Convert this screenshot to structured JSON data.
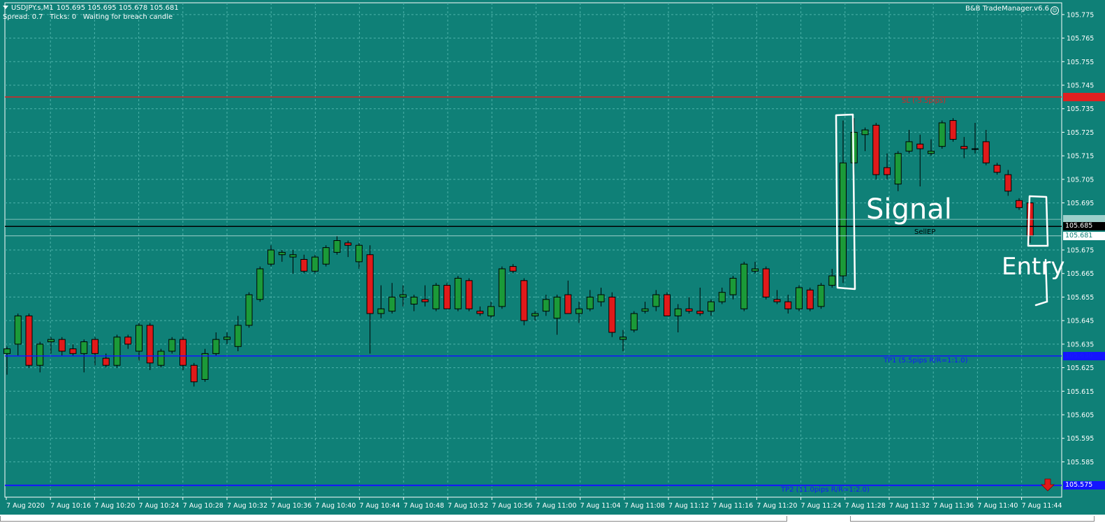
{
  "header": {
    "symbol": "USDJPY.s,M1",
    "ohlc": "105.695 105.695 105.678 105.681",
    "status_line": "Spread: 0.7   Ticks: 0   Waiting for breach candle",
    "ea_name": "B&B TradeManager.v6.6",
    "ea_icon": "smiley-icon"
  },
  "colors": {
    "background": "#0f8077",
    "grid": "#4db2aa",
    "bull": "#1b9a38",
    "bear": "#e01a1a",
    "wick": "#000000",
    "sl_line": "#e02020",
    "tp_line": "#1414ff",
    "entry_line": "#000000",
    "annotation": "#ffffff"
  },
  "price_axis": {
    "min": 105.57,
    "max": 105.78,
    "ticks": [
      "105.775",
      "105.765",
      "105.755",
      "105.745",
      "105.735",
      "105.725",
      "105.715",
      "105.705",
      "105.695",
      "105.675",
      "105.665",
      "105.655",
      "105.645",
      "105.635",
      "105.625",
      "105.615",
      "105.605",
      "105.595",
      "105.585"
    ]
  },
  "time_axis": {
    "labels": [
      "7 Aug 2020",
      "7 Aug 10:16",
      "7 Aug 10:20",
      "7 Aug 10:24",
      "7 Aug 10:28",
      "7 Aug 10:32",
      "7 Aug 10:36",
      "7 Aug 10:40",
      "7 Aug 10:44",
      "7 Aug 10:48",
      "7 Aug 10:52",
      "7 Aug 10:56",
      "7 Aug 11:00",
      "7 Aug 11:04",
      "7 Aug 11:08",
      "7 Aug 11:12",
      "7 Aug 11:16",
      "7 Aug 11:20",
      "7 Aug 11:24",
      "7 Aug 11:28",
      "7 Aug 11:32",
      "7 Aug 11:36",
      "7 Aug 11:40",
      "7 Aug 11:44"
    ]
  },
  "levels": {
    "sl": {
      "price": 105.74,
      "tag": "105.740",
      "label": "SL (-5.5pips)"
    },
    "entry": {
      "price": 105.685,
      "tag": "105.685",
      "label": "SellEP"
    },
    "tp1": {
      "price": 105.63,
      "tag": "105.630",
      "label": "TP1 (5.5pips R/R=1:1.0)"
    },
    "tp2": {
      "price": 105.575,
      "tag": "105.575",
      "label": "TP2 (11.0pips R/R=1:2.0)"
    },
    "ask": {
      "price": 105.688,
      "tag": "105.688"
    },
    "bid": {
      "price": 105.681,
      "tag": "105.681"
    }
  },
  "annotations": {
    "signal": "Signal",
    "entry": "Entry"
  },
  "chart_data": {
    "type": "candlestick",
    "title": "",
    "xlabel": "",
    "ylabel": "",
    "ylim": [
      105.57,
      105.78
    ],
    "candles": [
      {
        "o": 105.631,
        "h": 105.634,
        "l": 105.622,
        "c": 105.633
      },
      {
        "o": 105.635,
        "h": 105.648,
        "l": 105.63,
        "c": 105.647
      },
      {
        "o": 105.647,
        "h": 105.648,
        "l": 105.625,
        "c": 105.626
      },
      {
        "o": 105.626,
        "h": 105.636,
        "l": 105.623,
        "c": 105.635
      },
      {
        "o": 105.636,
        "h": 105.638,
        "l": 105.631,
        "c": 105.637
      },
      {
        "o": 105.637,
        "h": 105.638,
        "l": 105.63,
        "c": 105.632
      },
      {
        "o": 105.633,
        "h": 105.635,
        "l": 105.63,
        "c": 105.631
      },
      {
        "o": 105.631,
        "h": 105.637,
        "l": 105.623,
        "c": 105.636
      },
      {
        "o": 105.637,
        "h": 105.638,
        "l": 105.626,
        "c": 105.631
      },
      {
        "o": 105.629,
        "h": 105.631,
        "l": 105.625,
        "c": 105.626
      },
      {
        "o": 105.626,
        "h": 105.639,
        "l": 105.625,
        "c": 105.638
      },
      {
        "o": 105.638,
        "h": 105.639,
        "l": 105.633,
        "c": 105.635
      },
      {
        "o": 105.632,
        "h": 105.644,
        "l": 105.628,
        "c": 105.643
      },
      {
        "o": 105.643,
        "h": 105.644,
        "l": 105.624,
        "c": 105.627
      },
      {
        "o": 105.626,
        "h": 105.633,
        "l": 105.625,
        "c": 105.632
      },
      {
        "o": 105.632,
        "h": 105.638,
        "l": 105.631,
        "c": 105.637
      },
      {
        "o": 105.637,
        "h": 105.638,
        "l": 105.624,
        "c": 105.626
      },
      {
        "o": 105.626,
        "h": 105.627,
        "l": 105.617,
        "c": 105.619
      },
      {
        "o": 105.62,
        "h": 105.633,
        "l": 105.619,
        "c": 105.631
      },
      {
        "o": 105.631,
        "h": 105.64,
        "l": 105.63,
        "c": 105.637
      },
      {
        "o": 105.637,
        "h": 105.64,
        "l": 105.635,
        "c": 105.638
      },
      {
        "o": 105.634,
        "h": 105.647,
        "l": 105.632,
        "c": 105.643
      },
      {
        "o": 105.643,
        "h": 105.657,
        "l": 105.642,
        "c": 105.656
      },
      {
        "o": 105.654,
        "h": 105.668,
        "l": 105.653,
        "c": 105.667
      },
      {
        "o": 105.669,
        "h": 105.677,
        "l": 105.668,
        "c": 105.675
      },
      {
        "o": 105.673,
        "h": 105.675,
        "l": 105.67,
        "c": 105.674
      },
      {
        "o": 105.672,
        "h": 105.675,
        "l": 105.665,
        "c": 105.673
      },
      {
        "o": 105.671,
        "h": 105.673,
        "l": 105.665,
        "c": 105.666
      },
      {
        "o": 105.666,
        "h": 105.673,
        "l": 105.665,
        "c": 105.672
      },
      {
        "o": 105.669,
        "h": 105.677,
        "l": 105.668,
        "c": 105.676
      },
      {
        "o": 105.674,
        "h": 105.681,
        "l": 105.673,
        "c": 105.679
      },
      {
        "o": 105.678,
        "h": 105.679,
        "l": 105.672,
        "c": 105.677
      },
      {
        "o": 105.67,
        "h": 105.678,
        "l": 105.667,
        "c": 105.677
      },
      {
        "o": 105.673,
        "h": 105.677,
        "l": 105.631,
        "c": 105.648
      },
      {
        "o": 105.648,
        "h": 105.66,
        "l": 105.646,
        "c": 105.65
      },
      {
        "o": 105.649,
        "h": 105.661,
        "l": 105.648,
        "c": 105.655
      },
      {
        "o": 105.655,
        "h": 105.66,
        "l": 105.651,
        "c": 105.656
      },
      {
        "o": 105.652,
        "h": 105.656,
        "l": 105.649,
        "c": 105.655
      },
      {
        "o": 105.654,
        "h": 105.66,
        "l": 105.651,
        "c": 105.653
      },
      {
        "o": 105.65,
        "h": 105.661,
        "l": 105.649,
        "c": 105.66
      },
      {
        "o": 105.66,
        "h": 105.661,
        "l": 105.65,
        "c": 105.65
      },
      {
        "o": 105.65,
        "h": 105.664,
        "l": 105.649,
        "c": 105.663
      },
      {
        "o": 105.662,
        "h": 105.663,
        "l": 105.649,
        "c": 105.65
      },
      {
        "o": 105.649,
        "h": 105.651,
        "l": 105.647,
        "c": 105.648
      },
      {
        "o": 105.647,
        "h": 105.653,
        "l": 105.646,
        "c": 105.651
      },
      {
        "o": 105.651,
        "h": 105.668,
        "l": 105.65,
        "c": 105.667
      },
      {
        "o": 105.668,
        "h": 105.669,
        "l": 105.665,
        "c": 105.666
      },
      {
        "o": 105.662,
        "h": 105.663,
        "l": 105.643,
        "c": 105.645
      },
      {
        "o": 105.647,
        "h": 105.649,
        "l": 105.645,
        "c": 105.648
      },
      {
        "o": 105.649,
        "h": 105.656,
        "l": 105.647,
        "c": 105.654
      },
      {
        "o": 105.646,
        "h": 105.656,
        "l": 105.639,
        "c": 105.655
      },
      {
        "o": 105.656,
        "h": 105.662,
        "l": 105.648,
        "c": 105.648
      },
      {
        "o": 105.648,
        "h": 105.653,
        "l": 105.644,
        "c": 105.65
      },
      {
        "o": 105.65,
        "h": 105.658,
        "l": 105.649,
        "c": 105.655
      },
      {
        "o": 105.653,
        "h": 105.659,
        "l": 105.651,
        "c": 105.656
      },
      {
        "o": 105.655,
        "h": 105.657,
        "l": 105.638,
        "c": 105.64
      },
      {
        "o": 105.637,
        "h": 105.641,
        "l": 105.632,
        "c": 105.638
      },
      {
        "o": 105.641,
        "h": 105.649,
        "l": 105.64,
        "c": 105.648
      },
      {
        "o": 105.649,
        "h": 105.653,
        "l": 105.648,
        "c": 105.65
      },
      {
        "o": 105.651,
        "h": 105.658,
        "l": 105.649,
        "c": 105.656
      },
      {
        "o": 105.656,
        "h": 105.657,
        "l": 105.647,
        "c": 105.647
      },
      {
        "o": 105.647,
        "h": 105.652,
        "l": 105.64,
        "c": 105.65
      },
      {
        "o": 105.65,
        "h": 105.655,
        "l": 105.648,
        "c": 105.649
      },
      {
        "o": 105.649,
        "h": 105.659,
        "l": 105.647,
        "c": 105.648
      },
      {
        "o": 105.649,
        "h": 105.654,
        "l": 105.647,
        "c": 105.653
      },
      {
        "o": 105.653,
        "h": 105.659,
        "l": 105.652,
        "c": 105.657
      },
      {
        "o": 105.656,
        "h": 105.664,
        "l": 105.654,
        "c": 105.663
      },
      {
        "o": 105.65,
        "h": 105.67,
        "l": 105.649,
        "c": 105.669
      },
      {
        "o": 105.666,
        "h": 105.67,
        "l": 105.665,
        "c": 105.667
      },
      {
        "o": 105.667,
        "h": 105.668,
        "l": 105.654,
        "c": 105.655
      },
      {
        "o": 105.654,
        "h": 105.658,
        "l": 105.652,
        "c": 105.653
      },
      {
        "o": 105.653,
        "h": 105.656,
        "l": 105.648,
        "c": 105.65
      },
      {
        "o": 105.65,
        "h": 105.66,
        "l": 105.649,
        "c": 105.659
      },
      {
        "o": 105.658,
        "h": 105.659,
        "l": 105.649,
        "c": 105.65
      },
      {
        "o": 105.651,
        "h": 105.661,
        "l": 105.65,
        "c": 105.66
      },
      {
        "o": 105.66,
        "h": 105.667,
        "l": 105.659,
        "c": 105.664
      },
      {
        "o": 105.664,
        "h": 105.73,
        "l": 105.661,
        "c": 105.712
      },
      {
        "o": 105.712,
        "h": 105.731,
        "l": 105.707,
        "c": 105.725
      },
      {
        "o": 105.724,
        "h": 105.727,
        "l": 105.717,
        "c": 105.726
      },
      {
        "o": 105.728,
        "h": 105.729,
        "l": 105.705,
        "c": 105.707
      },
      {
        "o": 105.71,
        "h": 105.716,
        "l": 105.705,
        "c": 105.707
      },
      {
        "o": 105.703,
        "h": 105.717,
        "l": 105.7,
        "c": 105.716
      },
      {
        "o": 105.717,
        "h": 105.726,
        "l": 105.716,
        "c": 105.721
      },
      {
        "o": 105.72,
        "h": 105.724,
        "l": 105.702,
        "c": 105.718
      },
      {
        "o": 105.716,
        "h": 105.722,
        "l": 105.715,
        "c": 105.717
      },
      {
        "o": 105.719,
        "h": 105.73,
        "l": 105.718,
        "c": 105.729
      },
      {
        "o": 105.73,
        "h": 105.731,
        "l": 105.721,
        "c": 105.722
      },
      {
        "o": 105.719,
        "h": 105.723,
        "l": 105.714,
        "c": 105.718
      },
      {
        "o": 105.718,
        "h": 105.729,
        "l": 105.716,
        "c": 105.718
      },
      {
        "o": 105.721,
        "h": 105.726,
        "l": 105.711,
        "c": 105.712
      },
      {
        "o": 105.711,
        "h": 105.712,
        "l": 105.707,
        "c": 105.708
      },
      {
        "o": 105.707,
        "h": 105.709,
        "l": 105.698,
        "c": 105.7
      },
      {
        "o": 105.696,
        "h": 105.697,
        "l": 105.692,
        "c": 105.693
      },
      {
        "o": 105.695,
        "h": 105.695,
        "l": 105.678,
        "c": 105.681
      }
    ]
  }
}
